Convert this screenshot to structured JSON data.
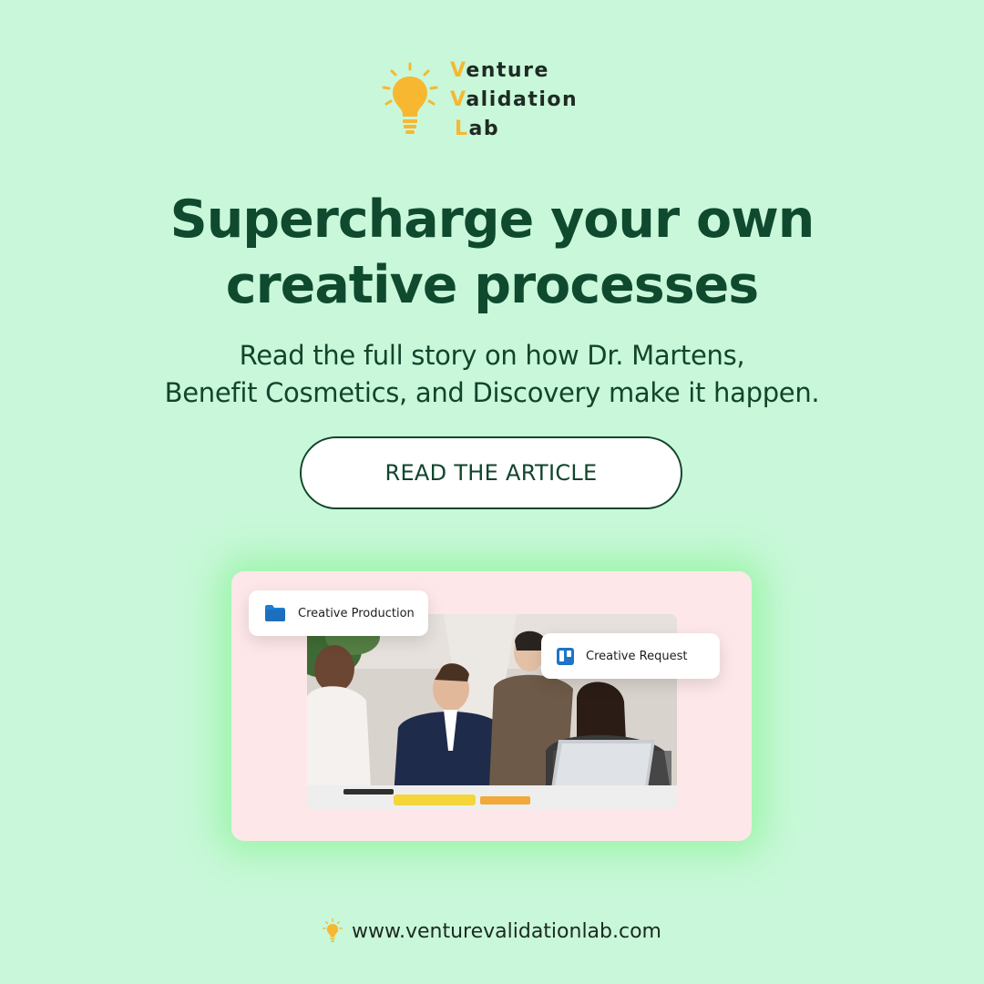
{
  "brand": {
    "lines": [
      {
        "initial": "V",
        "rest": "enture"
      },
      {
        "initial": "V",
        "rest": "alidation"
      },
      {
        "initial": "L",
        "rest": "ab"
      }
    ],
    "icon": "lightbulb-icon",
    "accent_color": "#f7b731",
    "text_color": "#1f2a24"
  },
  "headline": {
    "line1": "Supercharge your own",
    "line2": "creative processes",
    "color": "#0f4a2f"
  },
  "subtitle": {
    "line1": "Read the full story on how Dr. Martens,",
    "line2": "Benefit Cosmetics, and Discovery make it happen."
  },
  "cta": {
    "label": "READ THE ARTICLE"
  },
  "card": {
    "chips": [
      {
        "label": "Creative Production",
        "icon": "folder-icon",
        "icon_color": "#1a7fd4"
      },
      {
        "label": "Creative Request",
        "icon": "trello-board-icon",
        "icon_color": "#1f74c8"
      }
    ],
    "background": "#fde7e8",
    "glow_color": "#78f082"
  },
  "footer": {
    "url": "www.venturevalidationlab.com",
    "icon": "lightbulb-icon"
  },
  "colors": {
    "page_background": "#c8f8d9"
  }
}
